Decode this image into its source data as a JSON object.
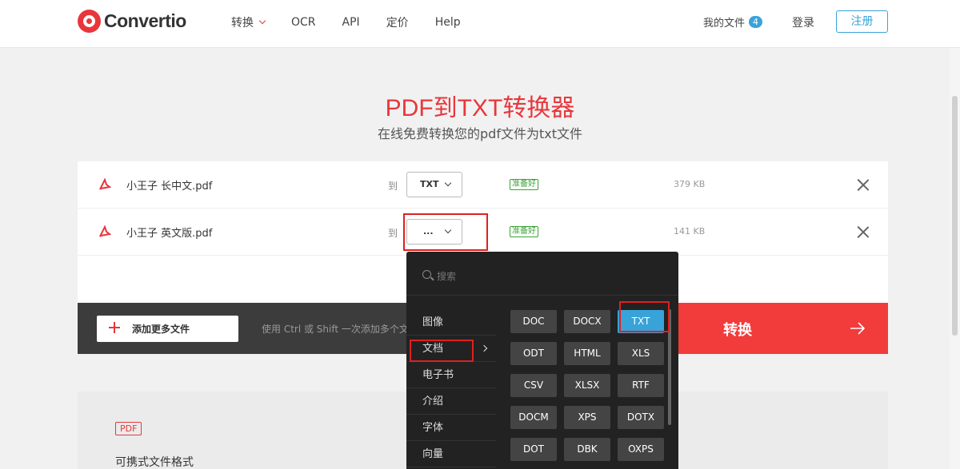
{
  "brand": {
    "name": "Convertio",
    "accent": "#e8363b"
  },
  "nav": [
    {
      "label": "转换",
      "has_dropdown": true
    },
    {
      "label": "OCR"
    },
    {
      "label": "API"
    },
    {
      "label": "定价"
    },
    {
      "label": "Help"
    }
  ],
  "header": {
    "my_files_label": "我的文件",
    "my_files_count": "4",
    "login_label": "登录",
    "register_label": "注册"
  },
  "page": {
    "title": "PDF到TXT转换器",
    "subtitle": "在线免费转换您的pdf文件为txt文件"
  },
  "files": [
    {
      "name": "小王子 长中文.pdf",
      "to_label": "到",
      "format": "TXT",
      "status": "准备好",
      "size": "379 KB"
    },
    {
      "name": "小王子 英文版.pdf",
      "to_label": "到",
      "format": "...",
      "status": "准备好",
      "size": "141 KB"
    }
  ],
  "action_bar": {
    "add_label": "添加更多文件",
    "hint": "使用 Ctrl 或 Shift 一次添加多个文件",
    "convert_label": "转换"
  },
  "lower": {
    "tag": "PDF",
    "description": "可携式文件格式"
  },
  "dropdown": {
    "search_placeholder": "搜索",
    "categories": [
      {
        "label": "图像"
      },
      {
        "label": "文档",
        "selected": true
      },
      {
        "label": "电子书"
      },
      {
        "label": "介绍"
      },
      {
        "label": "字体"
      },
      {
        "label": "向量"
      }
    ],
    "formats": [
      [
        "DOC",
        "DOCX",
        "TXT"
      ],
      [
        "ODT",
        "HTML",
        "XLS"
      ],
      [
        "CSV",
        "XLSX",
        "RTF"
      ],
      [
        "DOCM",
        "XPS",
        "DOTX"
      ],
      [
        "DOT",
        "DBK",
        "OXPS"
      ]
    ],
    "active_format": "TXT"
  },
  "colors": {
    "status_green": "#3aa335",
    "link_blue": "#38a3d9",
    "convert_red": "#f23b3b"
  },
  "icons": [
    "pdf-file-icon",
    "close-icon",
    "plus-icon",
    "arrow-right-icon",
    "search-icon",
    "chevron-down-icon",
    "chevron-right-icon"
  ]
}
